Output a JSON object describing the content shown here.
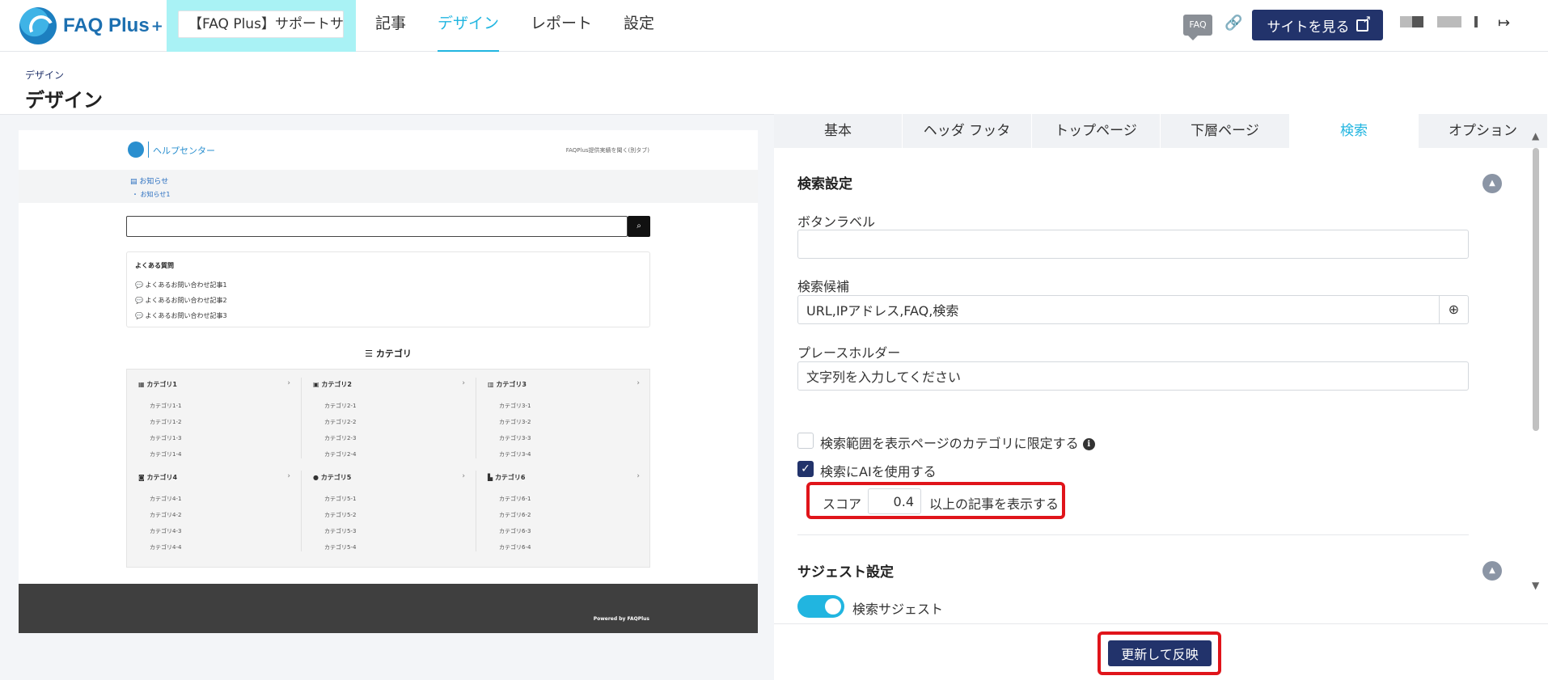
{
  "app": {
    "name": "FAQ Plus",
    "name_plus": "+"
  },
  "site_selector": {
    "value": "【FAQ Plus】サポートサ"
  },
  "nav": {
    "items": [
      {
        "label": "記事"
      },
      {
        "label": "デザイン",
        "active": true
      },
      {
        "label": "レポート"
      },
      {
        "label": "設定"
      }
    ]
  },
  "header_actions": {
    "faq_badge": "FAQ",
    "view_site_label": "サイトを見る"
  },
  "page": {
    "breadcrumb": "デザイン",
    "title": "デザイン"
  },
  "preview": {
    "brand": "ヘルプセンター",
    "top_link": "FAQPlus提供実績を聞く(別タブ)",
    "news_title": "お知らせ",
    "news_item": "・ お知らせ1",
    "faq_title": "よくある質問",
    "faq_items": [
      "よくあるお問い合わせ記事1",
      "よくあるお問い合わせ記事2",
      "よくあるお問い合わせ記事3"
    ],
    "category_heading": "カテゴリ",
    "categories": [
      {
        "name": "カテゴリ1",
        "subs": [
          "カテゴリ1-1",
          "カテゴリ1-2",
          "カテゴリ1-3",
          "カテゴリ1-4"
        ]
      },
      {
        "name": "カテゴリ2",
        "subs": [
          "カテゴリ2-1",
          "カテゴリ2-2",
          "カテゴリ2-3",
          "カテゴリ2-4"
        ]
      },
      {
        "name": "カテゴリ3",
        "subs": [
          "カテゴリ3-1",
          "カテゴリ3-2",
          "カテゴリ3-3",
          "カテゴリ3-4"
        ]
      },
      {
        "name": "カテゴリ4",
        "subs": [
          "カテゴリ4-1",
          "カテゴリ4-2",
          "カテゴリ4-3",
          "カテゴリ4-4"
        ]
      },
      {
        "name": "カテゴリ5",
        "subs": [
          "カテゴリ5-1",
          "カテゴリ5-2",
          "カテゴリ5-3",
          "カテゴリ5-4"
        ]
      },
      {
        "name": "カテゴリ6",
        "subs": [
          "カテゴリ6-1",
          "カテゴリ6-2",
          "カテゴリ6-3",
          "カテゴリ6-4"
        ]
      }
    ],
    "powered_by": "Powered by FAQPlus"
  },
  "tabs": [
    {
      "label": "基本"
    },
    {
      "label": "ヘッダ フッタ"
    },
    {
      "label": "トップページ"
    },
    {
      "label": "下層ページ"
    },
    {
      "label": "検索",
      "active": true
    },
    {
      "label": "オプション"
    }
  ],
  "search_settings": {
    "title": "検索設定",
    "button_label": {
      "label": "ボタンラベル",
      "value": ""
    },
    "suggestions": {
      "label": "検索候補",
      "value": "URL,IPアドレス,FAQ,検索"
    },
    "placeholder": {
      "label": "プレースホルダー",
      "value": "文字列を入力してください"
    },
    "limit_scope": {
      "label": "検索範囲を表示ページのカテゴリに限定する",
      "checked": false
    },
    "use_ai": {
      "label": "検索にAIを使用する",
      "checked": true
    },
    "score": {
      "prefix": "スコア",
      "value": "0.4",
      "suffix": "以上の記事を表示する"
    }
  },
  "suggest_settings": {
    "title": "サジェスト設定",
    "search_suggest": {
      "label": "検索サジェスト",
      "on": true
    }
  },
  "footer": {
    "update_label": "更新して反映"
  },
  "colors": {
    "accent": "#21b5e0",
    "primary": "#22336b",
    "highlight": "#e0141a"
  }
}
